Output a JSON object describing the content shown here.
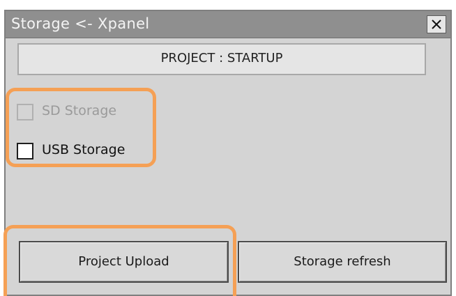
{
  "window": {
    "title": "Storage <- Xpanel"
  },
  "project": {
    "label": "PROJECT : STARTUP"
  },
  "storage_options": [
    {
      "label": "SD Storage",
      "checked": false,
      "enabled": false
    },
    {
      "label": "USB Storage",
      "checked": false,
      "enabled": true
    }
  ],
  "buttons": {
    "upload_label": "Project Upload",
    "refresh_label": "Storage refresh"
  },
  "colors": {
    "highlight": "#f5a055",
    "titlebar": "#8f8f8f",
    "window_bg": "#d4d4d4"
  },
  "icons": {
    "close": "close-icon"
  }
}
